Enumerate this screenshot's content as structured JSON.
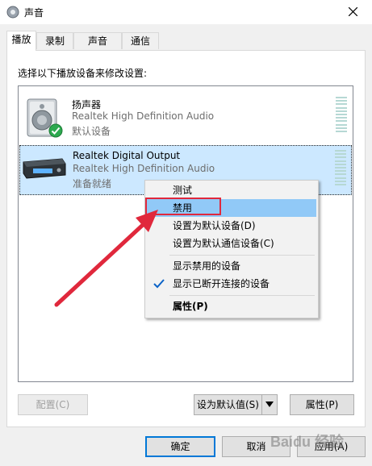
{
  "window": {
    "title": "声音"
  },
  "tabs": [
    {
      "label": "播放",
      "active": true
    },
    {
      "label": "录制",
      "active": false
    },
    {
      "label": "声音",
      "active": false
    },
    {
      "label": "通信",
      "active": false
    }
  ],
  "instruction": "选择以下播放设备来修改设置:",
  "devices": [
    {
      "name": "扬声器",
      "driver": "Realtek High Definition Audio",
      "status": "默认设备",
      "icon": "speaker-icon",
      "default": true,
      "selected": false
    },
    {
      "name": "Realtek Digital Output",
      "driver": "Realtek High Definition Audio",
      "status": "准备就绪",
      "icon": "digital-output-icon",
      "default": false,
      "selected": true
    }
  ],
  "context_menu": {
    "items": [
      {
        "label": "测试",
        "highlighted": false
      },
      {
        "label": "禁用",
        "highlighted": true
      },
      {
        "label": "设置为默认设备(D)",
        "highlighted": false
      },
      {
        "label": "设置为默认通信设备(C)",
        "highlighted": false
      },
      {
        "label": "显示禁用的设备",
        "highlighted": false
      },
      {
        "label": "显示已断开连接的设备",
        "highlighted": false,
        "checked": true
      },
      {
        "label": "属性(P)",
        "highlighted": false,
        "bold": true
      }
    ]
  },
  "buttons": {
    "configure": "配置(C)",
    "set_default": "设为默认值(S)",
    "properties": "属性(P)",
    "ok": "确定",
    "cancel": "取消",
    "apply": "应用(A)"
  },
  "watermark": "Baidu 经验",
  "colors": {
    "selection": "#cce8ff",
    "menu_highlight": "#91c9f7",
    "annotation_red": "#e0283c",
    "focus_blue": "#0078d7"
  }
}
